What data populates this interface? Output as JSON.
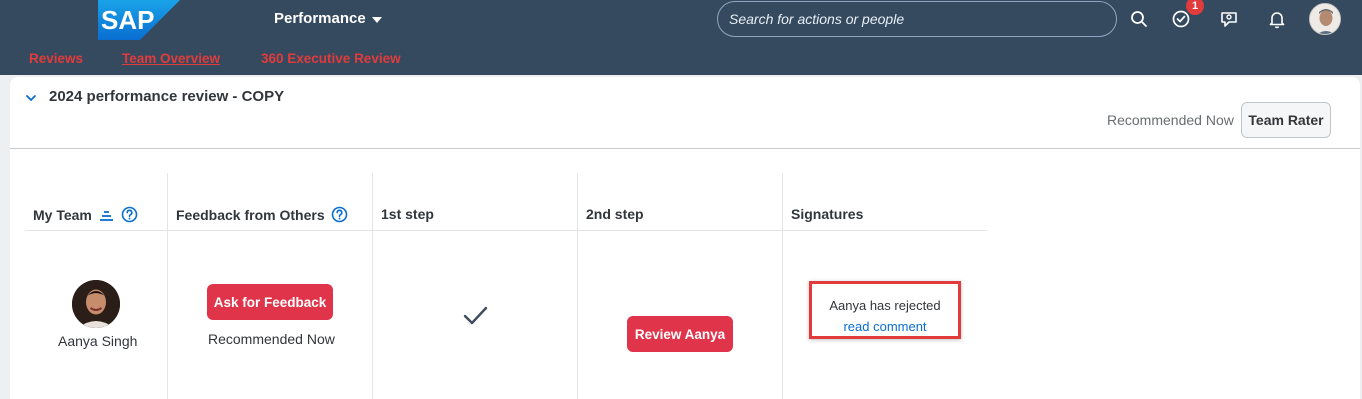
{
  "shell": {
    "logo_text": "SAP",
    "app_title": "Performance",
    "search_placeholder": "Search for actions or people",
    "notification_badge": "1",
    "icons": [
      "search-icon",
      "todo-check-icon",
      "feedback-icon",
      "bell-icon",
      "user-avatar"
    ]
  },
  "subnav": {
    "items": [
      {
        "label": "Reviews"
      },
      {
        "label": "Team Overview",
        "active": true
      },
      {
        "label": "360 Executive Review"
      }
    ]
  },
  "section": {
    "title": "2024 performance review - COPY",
    "recommended_label": "Recommended Now",
    "team_rater_button": "Team Rater"
  },
  "table": {
    "headers": {
      "my_team": "My Team",
      "feedback": "Feedback from Others",
      "step1": "1st step",
      "step2": "2nd step",
      "signatures": "Signatures"
    },
    "row": {
      "name": "Aanya Singh",
      "feedback_button": "Ask for Feedback",
      "feedback_status": "Recommended Now",
      "step1_status": "completed",
      "step2_button": "Review Aanya",
      "signature_text": "Aanya has rejected",
      "signature_link": "read comment"
    }
  },
  "colors": {
    "shell_bg": "#354a5f",
    "accent_red": "#e0344a",
    "link_blue": "#0a6ed1",
    "highlight_border": "#e23b3b"
  }
}
